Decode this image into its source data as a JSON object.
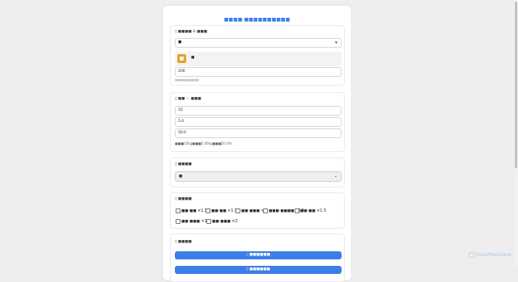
{
  "page": {
    "title": "■■■■-■■■■■■■■■■"
  },
  "item_section": {
    "label": "▯ ■■■■ & ■■■",
    "dropdown_value": "■",
    "item_name": "■",
    "quantity": "200",
    "hint": "■■■■■■■■■"
  },
  "weight_section": {
    "label": "▯ ■■ — ■■■",
    "field1": "10",
    "field2": "5.0",
    "field3": "50.0",
    "summary": "■■■10kg■■■5.00kg■■■50.0%"
  },
  "select_section": {
    "label": "▯ ■■■■",
    "selected": "■"
  },
  "modifiers_section": {
    "label": "▯ ■■■■",
    "options": [
      {
        "label": "■■-■■",
        "mult": "×1.5"
      },
      {
        "label": "■■-■■",
        "mult": "×1.5"
      },
      {
        "label": "■■-■■■",
        "mult": "×2"
      },
      {
        "label": "■■■-■■■■",
        "mult": "×10"
      },
      {
        "label": "■■-■■",
        "mult": "×1.5"
      },
      {
        "label": "■■-■■■",
        "mult": "×1.5"
      },
      {
        "label": "■■-■■■",
        "mult": "×2"
      }
    ]
  },
  "actions_section": {
    "label": "▯ ■■■■",
    "button1": "▯ ■■■■■■",
    "button2": "▯ ■■■■■■"
  },
  "watermark": {
    "text": "ScanMalware"
  }
}
